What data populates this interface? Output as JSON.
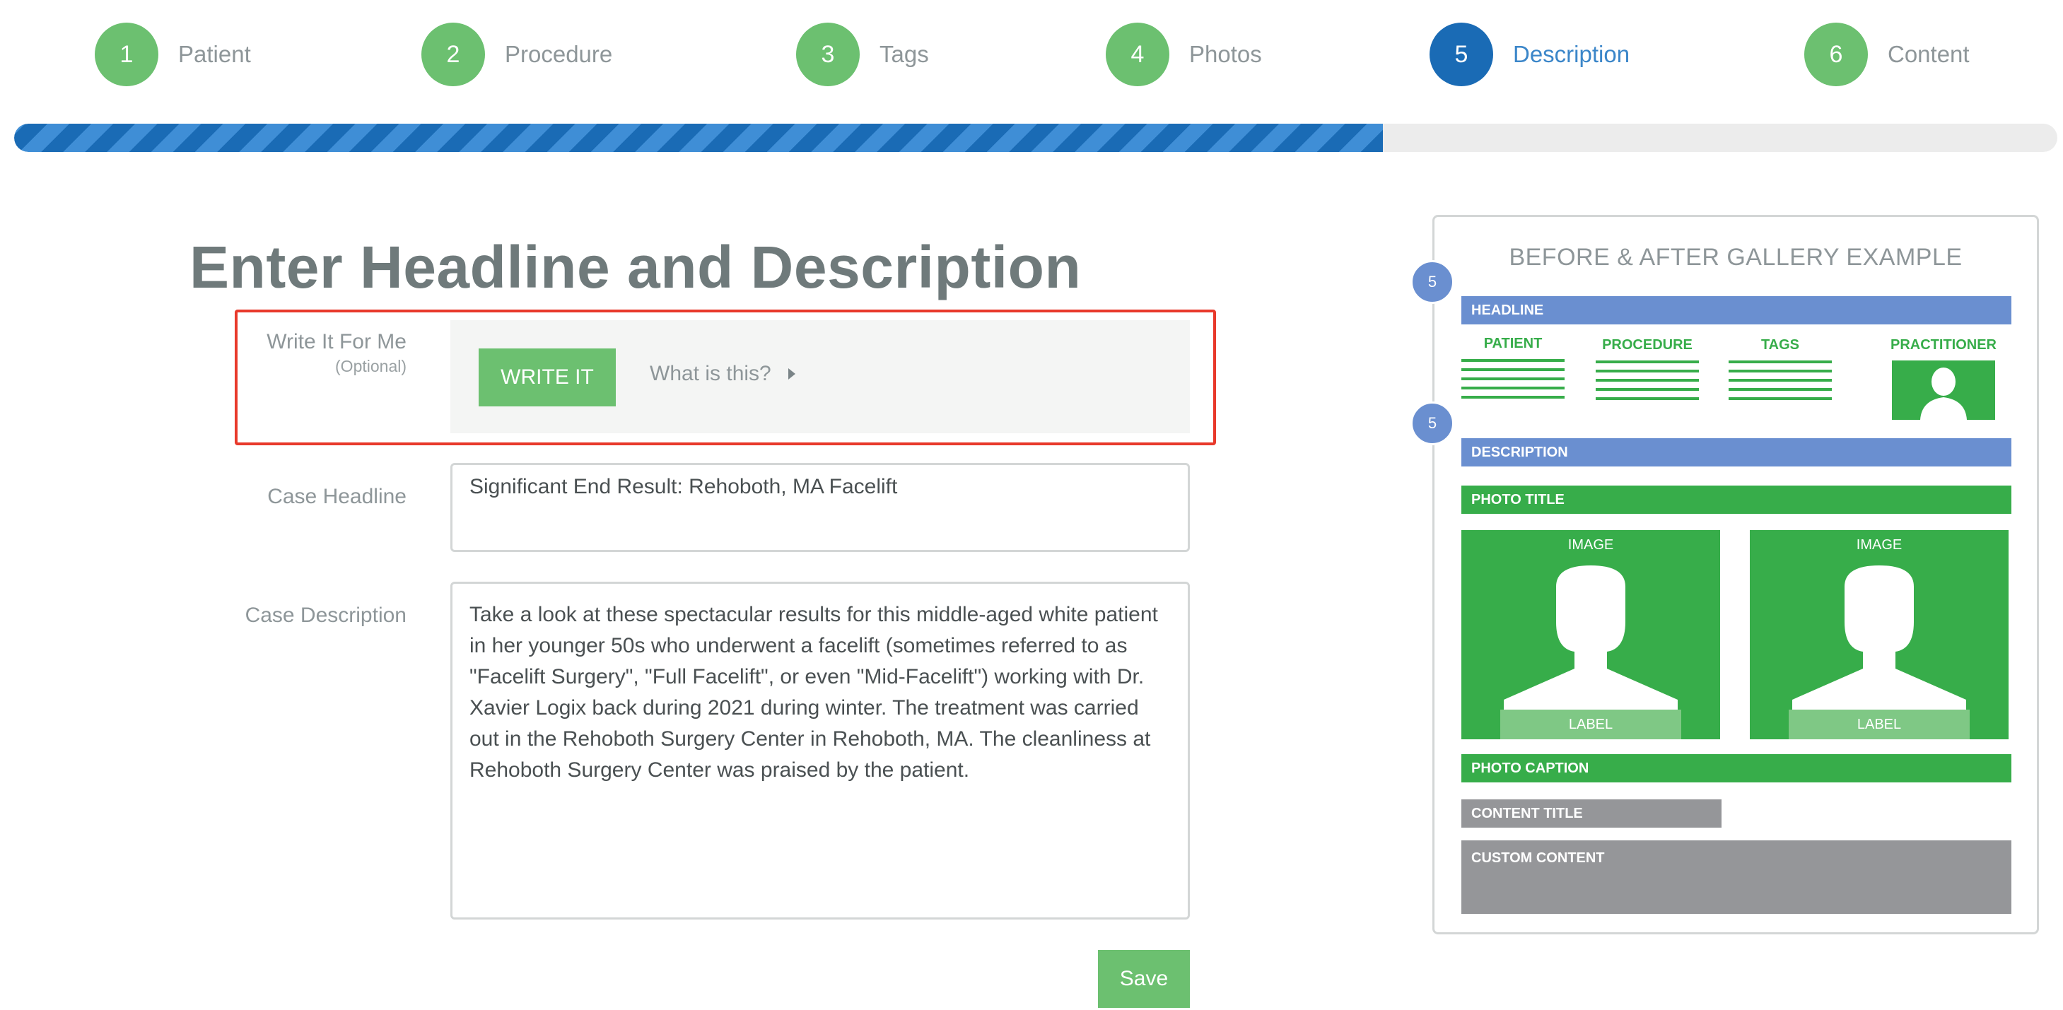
{
  "steps": [
    {
      "number": "1",
      "label": "Patient"
    },
    {
      "number": "2",
      "label": "Procedure"
    },
    {
      "number": "3",
      "label": "Tags"
    },
    {
      "number": "4",
      "label": "Photos"
    },
    {
      "number": "5",
      "label": "Description"
    },
    {
      "number": "6",
      "label": "Content"
    }
  ],
  "active_step": 5,
  "progress_percent": 67,
  "page_title": "Enter Headline and Description",
  "write_it": {
    "label": "Write It For Me",
    "sublabel": "(Optional)",
    "button": "WRITE IT",
    "help_link": "What is this?"
  },
  "headline": {
    "label": "Case Headline",
    "value": "Significant End Result: Rehoboth, MA Facelift"
  },
  "description": {
    "label": "Case Description",
    "value": "Take a look at these spectacular results for this middle-aged white patient in her younger 50s who underwent a facelift (sometimes referred to as \"Facelift Surgery\", \"Full Facelift\", or even \"Mid-Facelift\") working with Dr. Xavier Logix back during 2021 during winter. The treatment was carried out in the Rehoboth Surgery Center in Rehoboth, MA. The cleanliness at Rehoboth Surgery Center was praised by the patient."
  },
  "save_button": "Save",
  "gallery": {
    "title": "BEFORE & AFTER GALLERY EXAMPLE",
    "badge": "5",
    "headline": "HEADLINE",
    "columns": [
      "PATIENT",
      "PROCEDURE",
      "TAGS",
      "PRACTITIONER"
    ],
    "description": "DESCRIPTION",
    "photo_title": "PHOTO TITLE",
    "image_title": "IMAGE",
    "image_label": "LABEL",
    "photo_caption": "PHOTO CAPTION",
    "content_title": "CONTENT TITLE",
    "custom_content": "CUSTOM CONTENT"
  },
  "colors": {
    "step_green": "#6cc070",
    "step_active": "#1a6bb5",
    "highlight": "#e8392b",
    "gallery_blue": "#6a8fd0",
    "gallery_green": "#37ad4a",
    "gallery_gray": "#959699"
  }
}
